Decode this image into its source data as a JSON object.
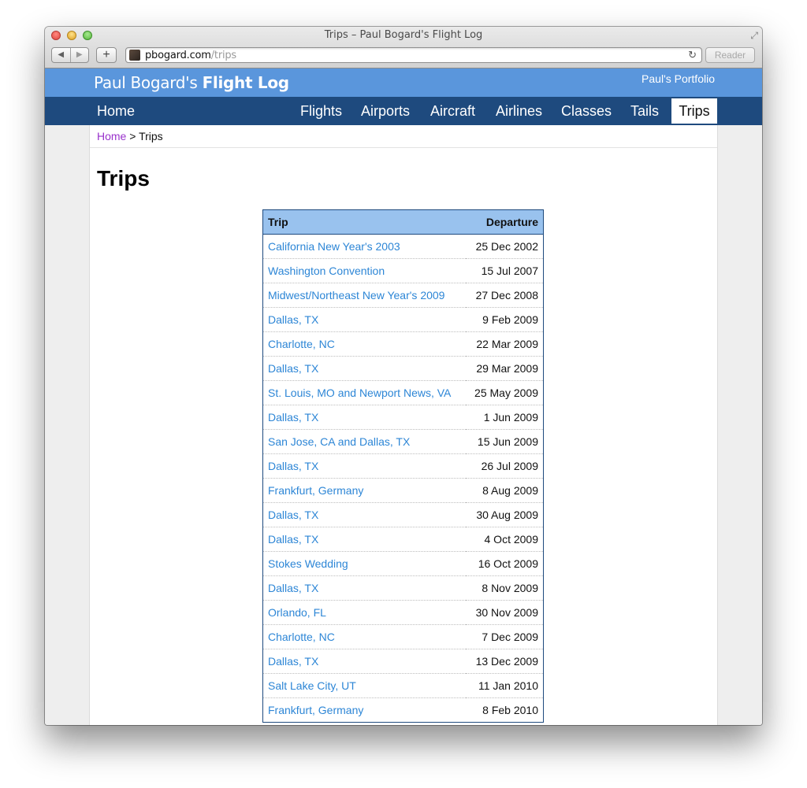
{
  "window": {
    "title": "Trips – Paul Bogard's Flight Log"
  },
  "toolbar": {
    "back_glyph": "◀",
    "forward_glyph": "▶",
    "new_tab_glyph": "+",
    "url_host": "pbogard.com",
    "url_path": "/trips",
    "reload_glyph": "↻",
    "reader_label": "Reader",
    "fullscreen_glyph": "⤢"
  },
  "site": {
    "title_light": "Paul Bogard's ",
    "title_bold": "Flight Log",
    "portfolio_link": "Paul's Portfolio"
  },
  "nav": {
    "home": "Home",
    "items": [
      "Flights",
      "Airports",
      "Aircraft",
      "Airlines",
      "Classes",
      "Tails"
    ],
    "active": "Trips"
  },
  "breadcrumb": {
    "home": "Home",
    "separator": " > ",
    "current": "Trips"
  },
  "page": {
    "heading": "Trips"
  },
  "table": {
    "headers": [
      "Trip",
      "Departure"
    ],
    "rows": [
      [
        "California New Year's 2003",
        "25 Dec 2002"
      ],
      [
        "Washington Convention",
        "15 Jul 2007"
      ],
      [
        "Midwest/Northeast New Year's 2009",
        "27 Dec 2008"
      ],
      [
        "Dallas, TX",
        "9 Feb 2009"
      ],
      [
        "Charlotte, NC",
        "22 Mar 2009"
      ],
      [
        "Dallas, TX",
        "29 Mar 2009"
      ],
      [
        "St. Louis, MO and Newport News, VA",
        "25 May 2009"
      ],
      [
        "Dallas, TX",
        "1 Jun 2009"
      ],
      [
        "San Jose, CA and Dallas, TX",
        "15 Jun 2009"
      ],
      [
        "Dallas, TX",
        "26 Jul 2009"
      ],
      [
        "Frankfurt, Germany",
        "8 Aug 2009"
      ],
      [
        "Dallas, TX",
        "30 Aug 2009"
      ],
      [
        "Dallas, TX",
        "4 Oct 2009"
      ],
      [
        "Stokes Wedding",
        "16 Oct 2009"
      ],
      [
        "Dallas, TX",
        "8 Nov 2009"
      ],
      [
        "Orlando, FL",
        "30 Nov 2009"
      ],
      [
        "Charlotte, NC",
        "7 Dec 2009"
      ],
      [
        "Dallas, TX",
        "13 Dec 2009"
      ],
      [
        "Salt Lake City, UT",
        "11 Jan 2010"
      ],
      [
        "Frankfurt, Germany",
        "8 Feb 2010"
      ]
    ]
  },
  "colors": {
    "header_blue": "#5a96dc",
    "nav_blue": "#1e4a7e",
    "table_header": "#99c2ee",
    "link_blue": "#2d86d6",
    "visited_purple": "#9932cc"
  }
}
